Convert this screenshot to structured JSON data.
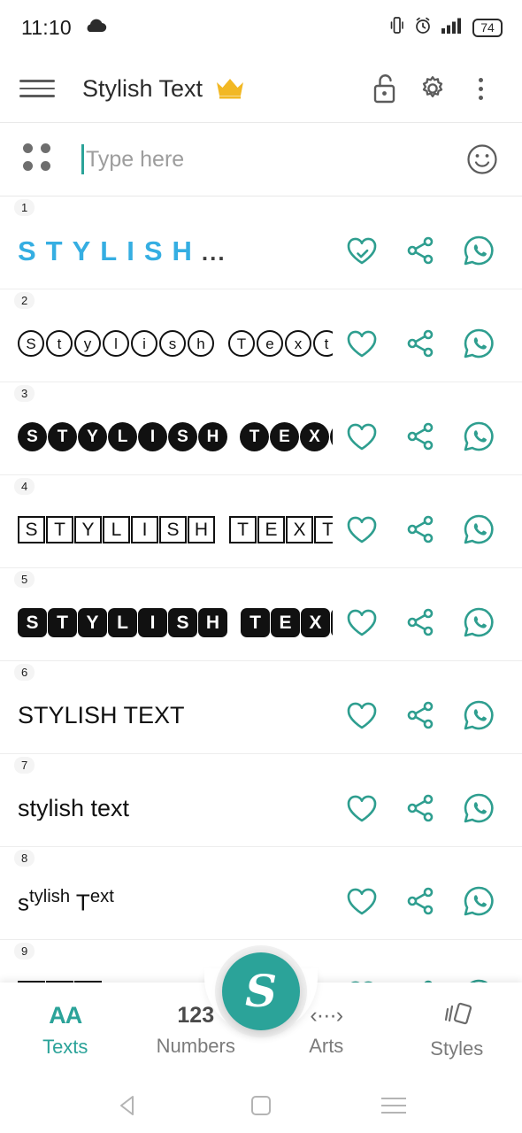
{
  "statusbar": {
    "time": "11:10",
    "cloud_icon": "cloud-icon",
    "vibrate_icon": "vibrate-icon",
    "alarm_icon": "alarm-icon",
    "signal_icon": "signal-bars-icon",
    "battery_level": "74"
  },
  "appbar": {
    "menu_icon": "hamburger-menu-icon",
    "title": "Stylish Text",
    "crown_icon": "crown-icon",
    "lock_icon": "unlocked-padlock-icon",
    "settings_icon": "gear-icon",
    "overflow_icon": "three-dot-menu-icon"
  },
  "input": {
    "grid_icon": "grid-dots-icon",
    "placeholder": "Type here",
    "value": "",
    "emoji_icon": "emoji-smiley-icon"
  },
  "actions": {
    "favorite_icon": "heart-icon",
    "favorited_icon": "heart-check-icon",
    "share_icon": "share-icon",
    "whatsapp_icon": "whatsapp-icon"
  },
  "styles": [
    {
      "num": "1",
      "variant": "blue",
      "text": "STYLISH",
      "ellipsis": "...",
      "favorited": true
    },
    {
      "num": "2",
      "variant": "circle-outline",
      "text": "Stylish Text",
      "favorited": false
    },
    {
      "num": "3",
      "variant": "circle-filled",
      "text": "STYLISH TEXT",
      "favorited": false
    },
    {
      "num": "4",
      "variant": "square-outline",
      "text": "STYLISH TEXT",
      "favorited": false
    },
    {
      "num": "5",
      "variant": "square-filled",
      "text": "STYLISH TEXT",
      "favorited": false
    },
    {
      "num": "6",
      "variant": "uppercase",
      "text": "STYLISH TEXT",
      "favorited": false
    },
    {
      "num": "7",
      "variant": "lowercase",
      "text": "stylish text",
      "favorited": false
    },
    {
      "num": "8",
      "variant": "superscript",
      "text": "stylish Text",
      "favorited": false
    },
    {
      "num": "9",
      "variant": "hidden",
      "text": "",
      "favorited": false
    }
  ],
  "bottomnav": {
    "items": [
      {
        "label": "Texts",
        "icon": "aa-letters-icon",
        "glyph": "AA",
        "active": true
      },
      {
        "label": "Numbers",
        "icon": "numbers-123-icon",
        "glyph": "123",
        "active": false
      },
      {
        "label": "Arts",
        "icon": "ascii-arts-icon",
        "glyph": "‹···›",
        "active": false
      },
      {
        "label": "Styles",
        "icon": "styles-cards-icon",
        "glyph": "",
        "active": false
      }
    ],
    "fab_icon": "script-s-logo-icon",
    "fab_glyph": "S",
    "active_color": "#2BA399"
  },
  "androidnav": {
    "back_icon": "back-triangle-icon",
    "home_icon": "home-square-icon",
    "recents_icon": "recents-menu-icon"
  }
}
